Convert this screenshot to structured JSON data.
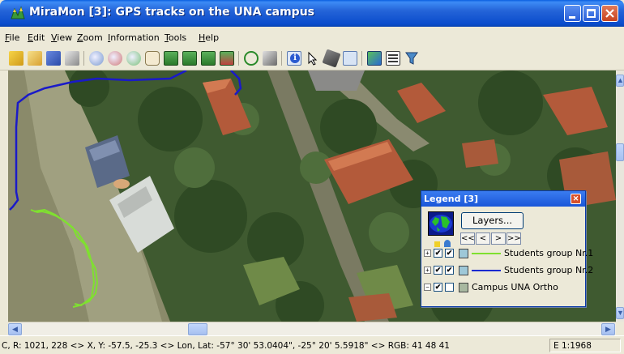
{
  "window": {
    "title": "MiraMon [3]:  GPS tracks on the UNA campus"
  },
  "menu": {
    "items": [
      {
        "label": "File",
        "underline": "F"
      },
      {
        "label": "Edit",
        "underline": "E"
      },
      {
        "label": "View",
        "underline": "V"
      },
      {
        "label": "Zoom",
        "underline": "Z"
      },
      {
        "label": "Information",
        "underline": "I"
      },
      {
        "label": "Tools",
        "underline": "T"
      },
      {
        "label": "Help",
        "underline": "H"
      }
    ]
  },
  "toolbar": {
    "icons": [
      "new-icon",
      "open-icon",
      "save-icon",
      "print-icon",
      "zoom-in-icon",
      "zoom-out-icon",
      "zoom-window-icon",
      "pan-hand-icon",
      "zoom-all-icon",
      "zoom-previous-icon",
      "zoom-next-icon",
      "zoom-layer-icon",
      "refresh-icon",
      "gps-icon",
      "info-icon",
      "select-arrow-icon",
      "eraser-icon",
      "measure-icon",
      "legend-icon",
      "layer-list-icon",
      "filter-icon"
    ]
  },
  "map": {
    "track_colors": {
      "group1": "#7fe030",
      "group2": "#1a1ac8"
    }
  },
  "legend": {
    "title": "Legend [3]",
    "layers_button": "Layers...",
    "nav_buttons": [
      "<<",
      "<",
      ">",
      ">>"
    ],
    "rows": [
      {
        "label": "Students group Nr.1",
        "expander": "+",
        "visible": true,
        "queryable": true,
        "color": "#7fe030"
      },
      {
        "label": "Students group Nr.2",
        "expander": "+",
        "visible": true,
        "queryable": true,
        "color": "#1a2ad0"
      },
      {
        "label": "Campus UNA Ortho",
        "expander": "−",
        "visible": true,
        "queryable": false,
        "color": ""
      }
    ]
  },
  "status": {
    "coords": "C, R: 1021, 228 <> X, Y: -57.5, -25.3 <> Lon, Lat: -57° 30' 53.0404\", -25° 20' 5.5918\" <> RGB:  41 48 41",
    "scale": "E 1:1968"
  }
}
